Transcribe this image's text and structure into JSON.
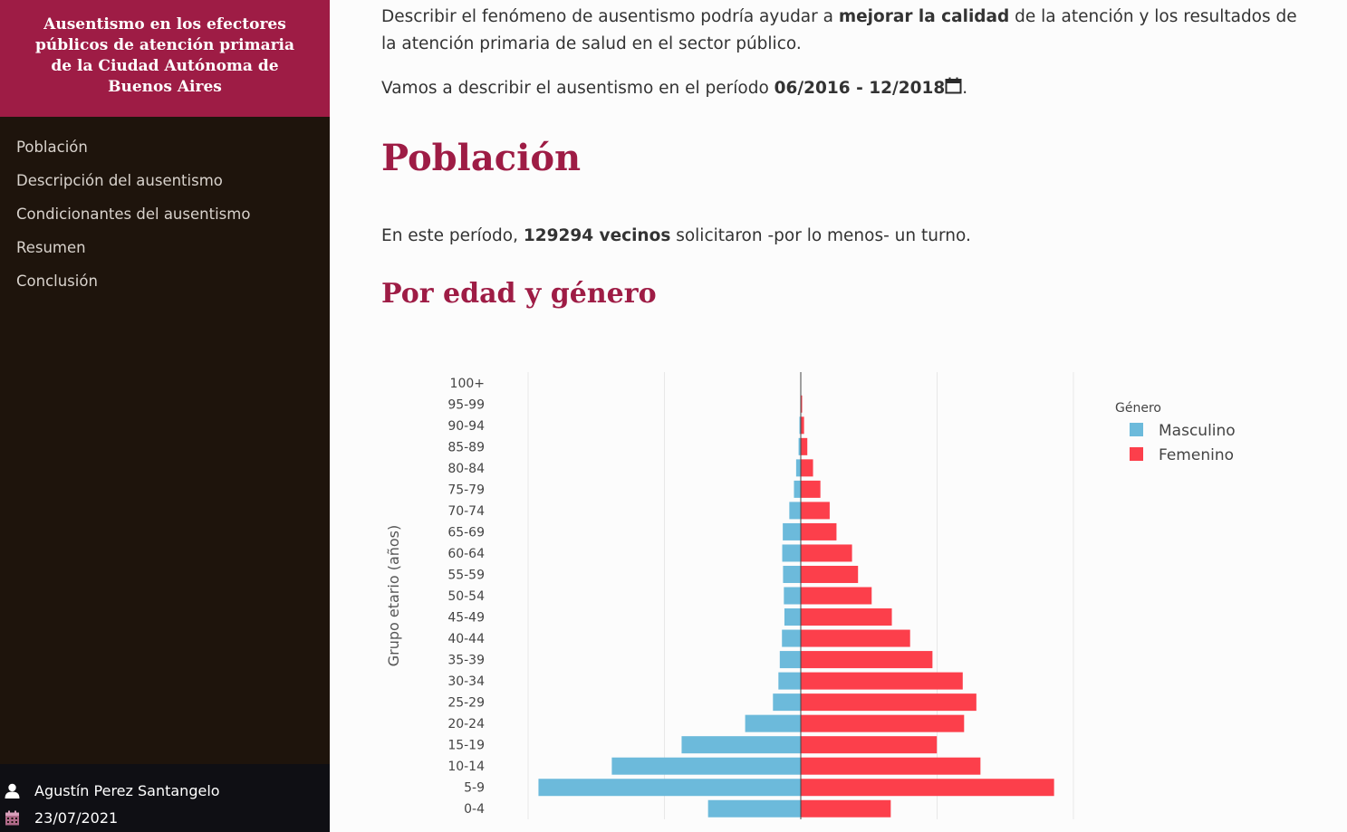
{
  "sidebar": {
    "title": "Ausentismo en los efectores públicos de atención primaria de la Ciudad Autónoma de Buenos Aires",
    "nav": [
      {
        "label": "Población"
      },
      {
        "label": "Descripción del ausentismo"
      },
      {
        "label": "Condicionantes del ausentismo"
      },
      {
        "label": "Resumen"
      },
      {
        "label": "Conclusión"
      }
    ],
    "footer": {
      "author": "Agustín Perez Santangelo",
      "date": "23/07/2021",
      "author_icon": "person-icon",
      "date_icon": "calendar-icon"
    }
  },
  "main": {
    "intro": {
      "pre": "Describir el fenómeno de ausentismo podría ayudar a ",
      "bold": "mejorar la calidad",
      "post": " de la atención y los resultados de la atención primaria de salud en el sector público."
    },
    "period": {
      "pre": "Vamos a describir el ausentismo en el período ",
      "bold": "06/2016 - 12/2018",
      "post": ".",
      "icon": "calendar-icon"
    },
    "section_heading": "Población",
    "count": {
      "pre": "En este período, ",
      "bold": "129294 vecinos",
      "post": " solicitaron -por lo menos- un turno."
    },
    "subheading": "Por edad y género"
  },
  "colors": {
    "accent": "#9e1c45",
    "sidebar_bg": "#1e140c",
    "masculino": "#6cbadb",
    "femenino": "#fc3f4b"
  },
  "chart_data": {
    "type": "bar",
    "orientation": "horizontal",
    "ylabel": "Grupo etario (años)",
    "legend_title": "Género",
    "legend_placement": "right",
    "grid": true,
    "categories": [
      "100+",
      "95-99",
      "90-94",
      "85-89",
      "80-84",
      "75-79",
      "70-74",
      "65-69",
      "60-64",
      "55-59",
      "50-54",
      "45-49",
      "40-44",
      "35-39",
      "30-34",
      "25-29",
      "20-24",
      "15-19",
      "10-14",
      "5-9",
      "0-4"
    ],
    "series": [
      {
        "name": "Masculino",
        "values": [
          5,
          10,
          50,
          80,
          170,
          250,
          420,
          660,
          680,
          650,
          620,
          600,
          690,
          770,
          820,
          1020,
          2040,
          4370,
          6930,
          9620,
          3400
        ]
      },
      {
        "name": "Femenino",
        "values": [
          10,
          50,
          120,
          240,
          450,
          720,
          1060,
          1310,
          1880,
          2100,
          2600,
          3340,
          4010,
          4830,
          5940,
          6440,
          5990,
          4990,
          6590,
          9290,
          3300
        ]
      }
    ]
  }
}
